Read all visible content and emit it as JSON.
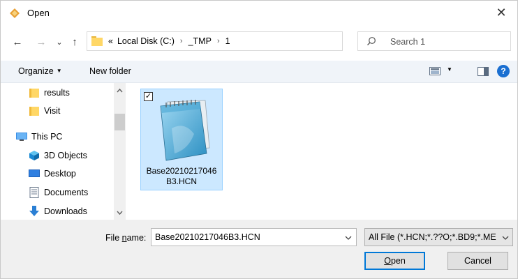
{
  "window": {
    "title": "Open",
    "close_glyph": "✕"
  },
  "nav": {
    "back_glyph": "←",
    "forward_glyph": "→",
    "recent_glyph": "⌄",
    "up_glyph": "↑"
  },
  "address": {
    "overflow_glyph": "«",
    "crumbs": [
      "Local Disk (C:)",
      "_TMP",
      "1"
    ],
    "separator": "›"
  },
  "search": {
    "placeholder": "Search 1"
  },
  "toolbar": {
    "organize": "Organize",
    "new_folder": "New folder",
    "help": "?"
  },
  "sidebar": {
    "items": [
      {
        "label": "results",
        "icon": "folder-icon"
      },
      {
        "label": "Visit",
        "icon": "folder-icon"
      },
      {
        "label": "This PC",
        "icon": "computer-icon"
      },
      {
        "label": "3D Objects",
        "icon": "cube-icon"
      },
      {
        "label": "Desktop",
        "icon": "desktop-icon"
      },
      {
        "label": "Documents",
        "icon": "documents-icon"
      },
      {
        "label": "Downloads",
        "icon": "download-icon"
      }
    ]
  },
  "files": [
    {
      "name": "Base20210217046B3.HCN",
      "name_line1": "Base20210217046",
      "name_line2": "B3.HCN",
      "selected": true,
      "icon": "notepad-icon"
    }
  ],
  "bottom": {
    "file_name_label_pre": "File ",
    "file_name_label_u": "n",
    "file_name_label_post": "ame:",
    "file_name_value": "Base20210217046B3.HCN",
    "file_type_value": "All File (*.HCN;*.??O;*.BD9;*.ME",
    "open_label_u": "O",
    "open_label_rest": "pen",
    "cancel_label": "Cancel"
  },
  "colors": {
    "accent": "#0078d7",
    "selection": "#cce8ff",
    "folder": "#ffd766"
  }
}
